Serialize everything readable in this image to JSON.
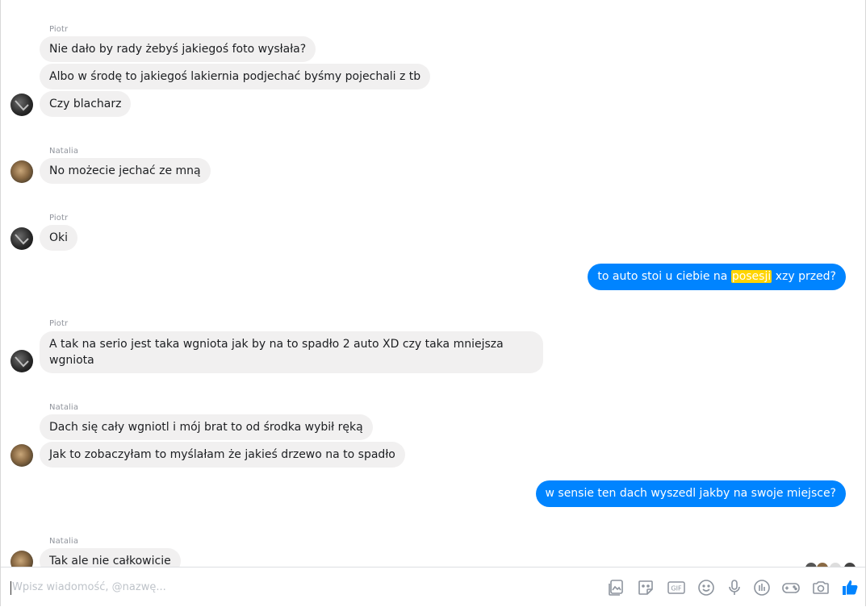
{
  "conversation": {
    "sender_piotr": "Piotr",
    "sender_natalia": "Natalia",
    "group1": [
      "Nie dało by rady żebyś jakiegoś foto wysłała?",
      "Albo w środę to jakiegoś lakiernia podjechać byśmy pojechali z tb",
      "Czy blacharz"
    ],
    "group2": [
      "No możecie jechać ze mną"
    ],
    "group3": [
      "Oki"
    ],
    "out1": {
      "before": "to auto stoi u ciebie na ",
      "highlight": "posesji",
      "after": " xzy przed?"
    },
    "group4": [
      "A tak na serio jest taka wgniota jak by na to spadło 2 auto XD czy taka mniejsza wgniota"
    ],
    "group5": [
      "Dach się cały wgniotl i mój brat to od środka wybił ręką",
      "Jak to zobaczyłam to myślałam że jakieś drzewo na to spadło"
    ],
    "out2": "w sensie ten dach wyszedl jakby na swoje miejsce?",
    "group6": [
      "Tak ale nie całkowicie"
    ]
  },
  "composer": {
    "placeholder": "Wpisz wiadomość, @nazwę..."
  },
  "toolbar_icons": [
    "photos-icon",
    "sticker-icon",
    "gif-icon",
    "emoji-icon",
    "microphone-icon",
    "poll-icon",
    "games-icon",
    "camera-icon",
    "like-icon"
  ],
  "colors": {
    "outgoing_bubble": "#0084ff",
    "incoming_bubble": "#f1f0f0",
    "highlight": "#ffd400",
    "icon": "#8d949e",
    "like": "#0084ff"
  }
}
